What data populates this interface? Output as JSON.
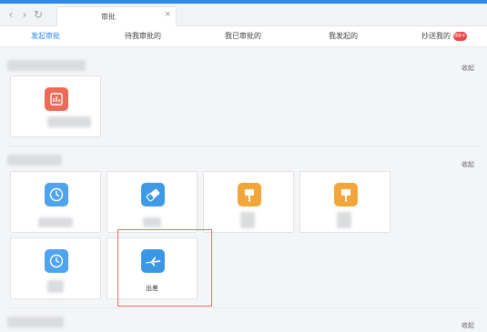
{
  "window": {
    "tab_title": "审批",
    "tab_close": "×",
    "back": "‹",
    "forward": "›",
    "refresh": "↻"
  },
  "subtabs": [
    {
      "label": "发起审批",
      "active": true
    },
    {
      "label": "待我审批的"
    },
    {
      "label": "我已审批的"
    },
    {
      "label": "我发起的"
    },
    {
      "label": "抄送我的",
      "badge": "99+"
    }
  ],
  "sections": [
    {
      "collapse_label": "收起"
    },
    {
      "collapse_label": "收起"
    },
    {
      "collapse_label": "收起"
    }
  ],
  "cards": [
    {
      "icon": "bar-chart-icon",
      "color": "#ee6a56"
    },
    {
      "icon": "clock-icon",
      "color": "#4fa3ec"
    },
    {
      "icon": "eraser-icon",
      "color": "#3e9ae8"
    },
    {
      "icon": "stamp-icon",
      "color": "#f2a63a"
    },
    {
      "icon": "stamp-icon",
      "color": "#f2a63a"
    },
    {
      "icon": "clock-icon",
      "color": "#4fa3ec"
    },
    {
      "icon": "airplane-icon",
      "color": "#3a97e6",
      "label": "出差"
    }
  ]
}
